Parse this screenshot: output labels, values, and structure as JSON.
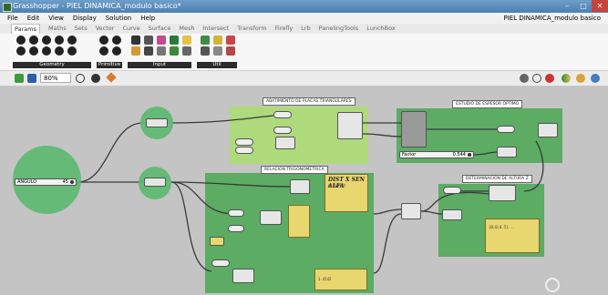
{
  "window": {
    "title": "Grasshopper - PIEL DINAMICA_modulo basico*",
    "controls": [
      "–",
      "□",
      "✕"
    ]
  },
  "menu": {
    "items": [
      "File",
      "Edit",
      "View",
      "Display",
      "Solution",
      "Help"
    ],
    "document": "PIEL DINAMICA_modulo basico"
  },
  "tabs": [
    "Params",
    "Maths",
    "Sets",
    "Vector",
    "Curve",
    "Surface",
    "Mesh",
    "Intersect",
    "Transform",
    "Firefly",
    "Lrb",
    "PanelingTools",
    "LunchBox"
  ],
  "active_tab": "Params",
  "ribbon_groups": [
    "Geometry",
    "Primitive",
    "Input",
    "Util"
  ],
  "toolbar": {
    "zoom": "80%"
  },
  "groups": {
    "abatimiento": "ABATIMIENTO DE PLACAS TRIANGULARES",
    "estudio": "ESTUDIO DE ESPESOR ÓPTIMO",
    "relacion": "RELACION TRIGONOMETRICA",
    "determinacion": "DETERMINACION DE ALTURA Z"
  },
  "slider_angulo": {
    "label": "ANGULO",
    "value": "45"
  },
  "slider_factor": {
    "label": "Factor",
    "value": "0.544"
  },
  "panel_dist": {
    "title": "DIST X SEN ALFA",
    "text": "0.707107"
  },
  "panel_bottom": {
    "text": "1.4142"
  },
  "panel_right": {
    "text": "{0;0;0.5}..."
  },
  "colors": {
    "canvas": "#c4c4c4",
    "group_green": "#5fb86a",
    "group_light": "#a9dd6e",
    "panel": "#e8d66f",
    "titlebar": "#4b7fb2"
  }
}
